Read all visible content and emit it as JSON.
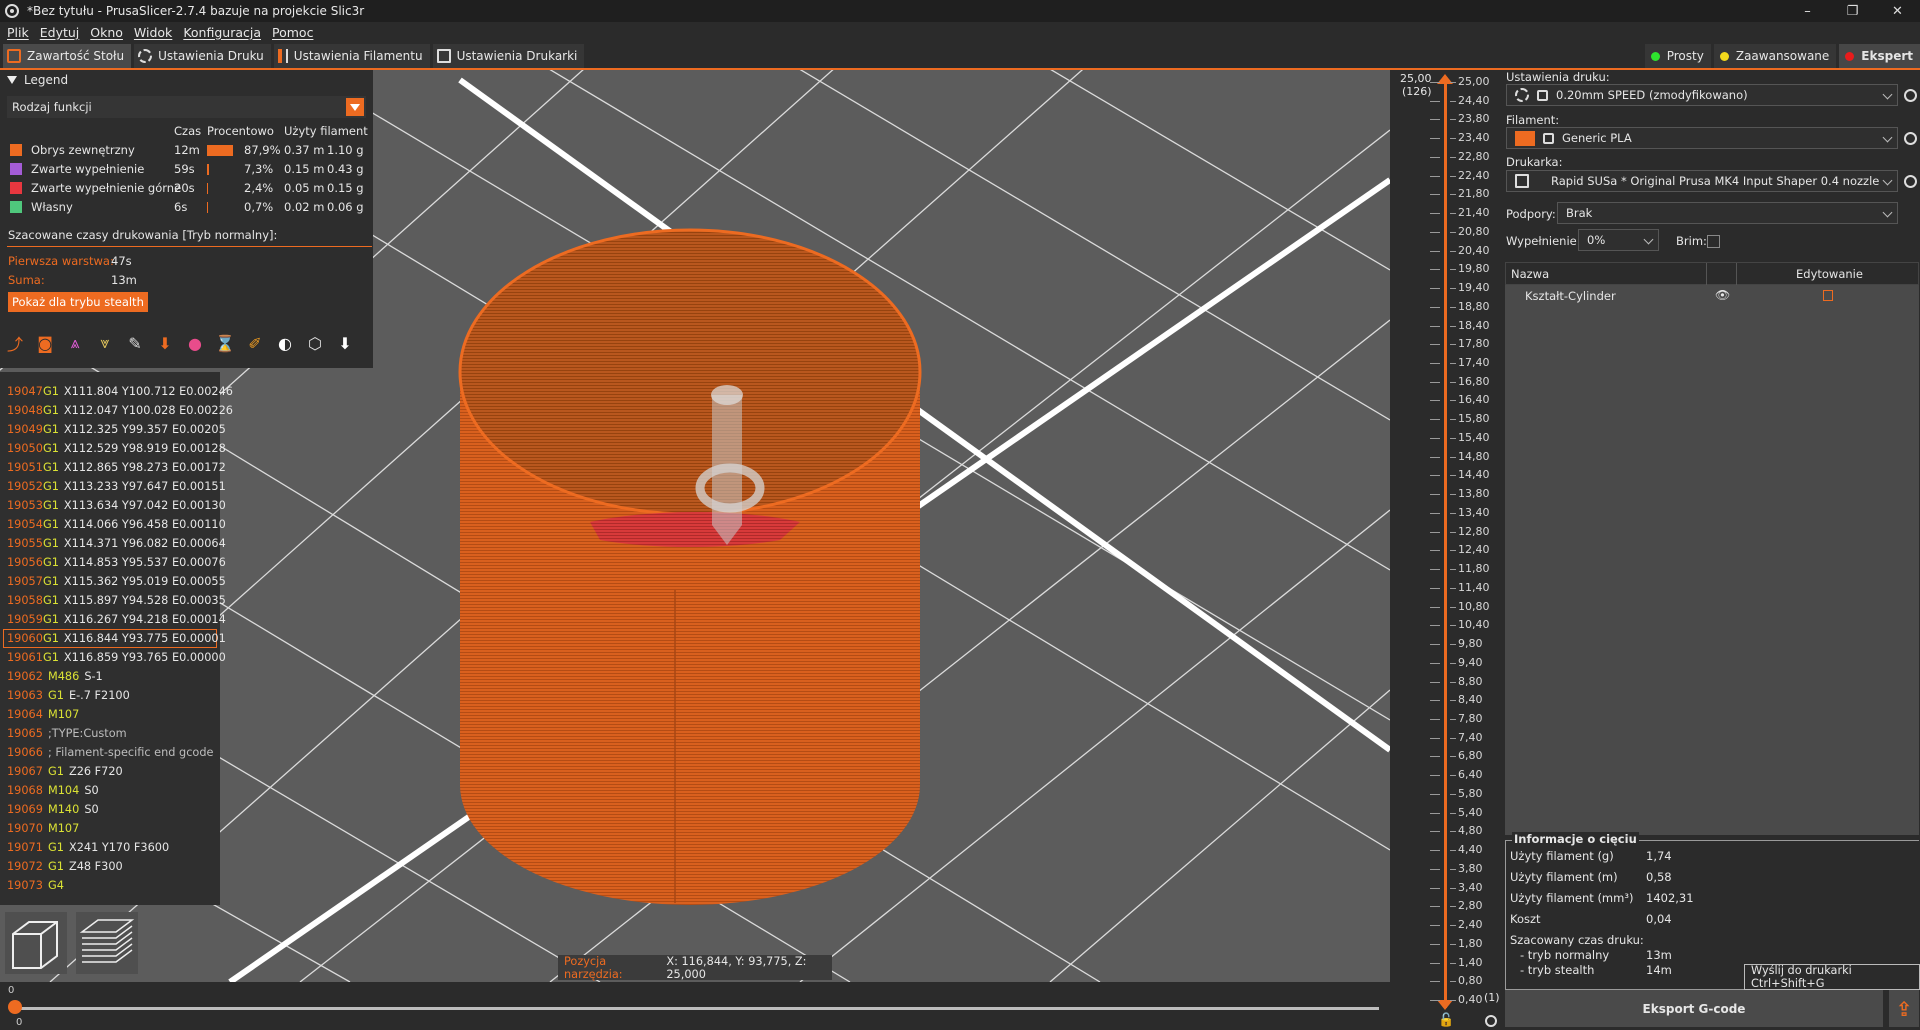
{
  "window": {
    "title": "*Bez tytułu - PrusaSlicer-2.7.4 bazuje na projekcie Slic3r",
    "minimize": "–",
    "maximize": "❐",
    "close": "✕"
  },
  "menu": [
    "Plik",
    "Edytuj",
    "Okno",
    "Widok",
    "Konfiguracja",
    "Pomoc"
  ],
  "tabs": [
    {
      "label": "Zawartość Stołu",
      "icon": "plate-icon",
      "active": true
    },
    {
      "label": "Ustawienia Druku",
      "icon": "gear-icon",
      "active": false
    },
    {
      "label": "Ustawienia Filamentu",
      "icon": "spool-icon",
      "active": false
    },
    {
      "label": "Ustawienia Drukarki",
      "icon": "printer-icon",
      "active": false
    }
  ],
  "modes": [
    {
      "label": "Prosty",
      "color": "#2ee32e"
    },
    {
      "label": "Zaawansowane",
      "color": "#f2d81c"
    },
    {
      "label": "Ekspert",
      "color": "#e81b1b",
      "active": true
    }
  ],
  "legend": {
    "title": "Legend",
    "selector": "Rodzaj funkcji",
    "headers": {
      "time": "Czas",
      "percent": "Procentowo",
      "filament": "Użyty filament"
    },
    "rows": [
      {
        "color": "#ed6b21",
        "name": "Obrys zewnętrzny",
        "time": "12m",
        "percent": "87,9%",
        "fraction": 0.879,
        "length": "0.37 m",
        "weight": "1.10 g"
      },
      {
        "color": "#a45cd6",
        "name": "Zwarte wypełnienie",
        "time": "59s",
        "percent": "7,3%",
        "fraction": 0.073,
        "length": "0.15 m",
        "weight": "0.43 g"
      },
      {
        "color": "#e8373f",
        "name": "Zwarte wypełnienie górne",
        "time": "20s",
        "percent": "2,4%",
        "fraction": 0.024,
        "length": "0.05 m",
        "weight": "0.15 g"
      },
      {
        "color": "#4fc77c",
        "name": "Własny",
        "time": "6s",
        "percent": "0,7%",
        "fraction": 0.007,
        "length": "0.02 m",
        "weight": "0.06 g"
      }
    ],
    "estimated_title": "Szacowane czasy drukowania [Tryb normalny]:",
    "first_layer_label": "Pierwsza warstwa:",
    "first_layer_value": "47s",
    "total_label": "Suma:",
    "total_value": "13m",
    "stealth_button": "Pokaż dla trybu stealth"
  },
  "gcode": [
    {
      "ln": "19047",
      "cmd": "G1",
      "args": "X111.804 Y100.712 E0.00246"
    },
    {
      "ln": "19048",
      "cmd": "G1",
      "args": "X112.047 Y100.028 E0.00226"
    },
    {
      "ln": "19049",
      "cmd": "G1",
      "args": "X112.325 Y99.357 E0.00205"
    },
    {
      "ln": "19050",
      "cmd": "G1",
      "args": "X112.529 Y98.919 E0.00128"
    },
    {
      "ln": "19051",
      "cmd": "G1",
      "args": "X112.865 Y98.273 E0.00172"
    },
    {
      "ln": "19052",
      "cmd": "G1",
      "args": "X113.233 Y97.647 E0.00151"
    },
    {
      "ln": "19053",
      "cmd": "G1",
      "args": "X113.634 Y97.042 E0.00130"
    },
    {
      "ln": "19054",
      "cmd": "G1",
      "args": "X114.066 Y96.458 E0.00110"
    },
    {
      "ln": "19055",
      "cmd": "G1",
      "args": "X114.371 Y96.082 E0.00064"
    },
    {
      "ln": "19056",
      "cmd": "G1",
      "args": "X114.853 Y95.537 E0.00076"
    },
    {
      "ln": "19057",
      "cmd": "G1",
      "args": "X115.362 Y95.019 E0.00055"
    },
    {
      "ln": "19058",
      "cmd": "G1",
      "args": "X115.897 Y94.528 E0.00035"
    },
    {
      "ln": "19059",
      "cmd": "G1",
      "args": "X116.267 Y94.218 E0.00014"
    },
    {
      "ln": "19060",
      "cmd": "G1",
      "args": "X116.844 Y93.775 E0.00001",
      "highlight": true
    },
    {
      "ln": "19061",
      "cmd": "G1",
      "args": "X116.859 Y93.765 E0.00000"
    },
    {
      "ln": "19062",
      "cmd": "M486",
      "args": "S-1"
    },
    {
      "ln": "19063",
      "cmd": "G1",
      "args": "E-.7 F2100"
    },
    {
      "ln": "19064",
      "cmd": "M107",
      "args": ""
    },
    {
      "ln": "19065",
      "cmd": "",
      "args": ";TYPE:Custom",
      "comment": true
    },
    {
      "ln": "19066",
      "cmd": "",
      "args": "; Filament-specific end gcode",
      "comment": true
    },
    {
      "ln": "19067",
      "cmd": "G1",
      "args": "Z26 F720"
    },
    {
      "ln": "19068",
      "cmd": "M104",
      "args": "S0"
    },
    {
      "ln": "19069",
      "cmd": "M140",
      "args": "S0"
    },
    {
      "ln": "19070",
      "cmd": "M107",
      "args": ""
    },
    {
      "ln": "19071",
      "cmd": "G1",
      "args": "X241 Y170 F3600"
    },
    {
      "ln": "19072",
      "cmd": "G1",
      "args": "Z48 F300"
    },
    {
      "ln": "19073",
      "cmd": "G4",
      "args": ""
    }
  ],
  "tool_position": {
    "label": "Pozycja narzędzia:",
    "value": "X: 116,844, Y: 93,775, Z: 25,000"
  },
  "horizontal_slider": {
    "top_label": "0",
    "bottom_label": "0",
    "position": 0
  },
  "vertical_slider": {
    "top_value": "25,00",
    "top_layer": "(126)",
    "bottom_value": "0,80",
    "bottom_layer": "(1)",
    "labels": [
      "25,00",
      "24,40",
      "23,80",
      "23,40",
      "22,80",
      "22,40",
      "21,80",
      "21,40",
      "20,80",
      "20,40",
      "19,80",
      "19,40",
      "18,80",
      "18,40",
      "17,80",
      "17,40",
      "16,80",
      "16,40",
      "15,80",
      "15,40",
      "14,80",
      "14,40",
      "13,80",
      "13,40",
      "12,80",
      "12,40",
      "11,80",
      "11,40",
      "10,80",
      "10,40",
      "9,80",
      "9,40",
      "8,80",
      "8,40",
      "7,80",
      "7,40",
      "6,80",
      "6,40",
      "5,80",
      "5,40",
      "4,80",
      "4,40",
      "3,80",
      "3,40",
      "2,80",
      "2,40",
      "1,80",
      "1,40",
      "0,80",
      "0,40",
      "0,80"
    ]
  },
  "sidebar": {
    "print_settings_label": "Ustawienia druku:",
    "print_settings_value": "0.20mm SPEED (zmodyfikowano)",
    "filament_label": "Filament:",
    "filament_value": "Generic PLA",
    "filament_color": "#ed6b21",
    "printer_label": "Drukarka:",
    "printer_value": "Rapid SUSa * Original Prusa MK4 Input Shaper 0.4 nozzle",
    "supports_label": "Podpory:",
    "supports_value": "Brak",
    "infill_label": "Wypełnienie:",
    "infill_value": "0%",
    "brim_label": "Brim:",
    "brim_checked": false,
    "object_list": {
      "col_name": "Nazwa",
      "col_edit": "Edytowanie",
      "items": [
        {
          "name": "Kształt-Cylinder"
        }
      ]
    },
    "slice_info": {
      "title": "Informacje o cięciu",
      "rows": [
        {
          "label": "Użyty filament (g)",
          "value": "1,74"
        },
        {
          "label": "Użyty filament (m)",
          "value": "0,58"
        },
        {
          "label": "Użyty filament (mm³)",
          "value": "1402,31"
        },
        {
          "label": "Koszt",
          "value": "0,04"
        }
      ],
      "time_label": "Szacowany czas druku:",
      "normal_label": "- tryb normalny",
      "normal_value": "13m",
      "stealth_label": "- tryb stealth",
      "stealth_value": "14m"
    },
    "export_button": "Eksport G-code",
    "send_tooltip": "Wyślij do drukarki Ctrl+Shift+G"
  }
}
